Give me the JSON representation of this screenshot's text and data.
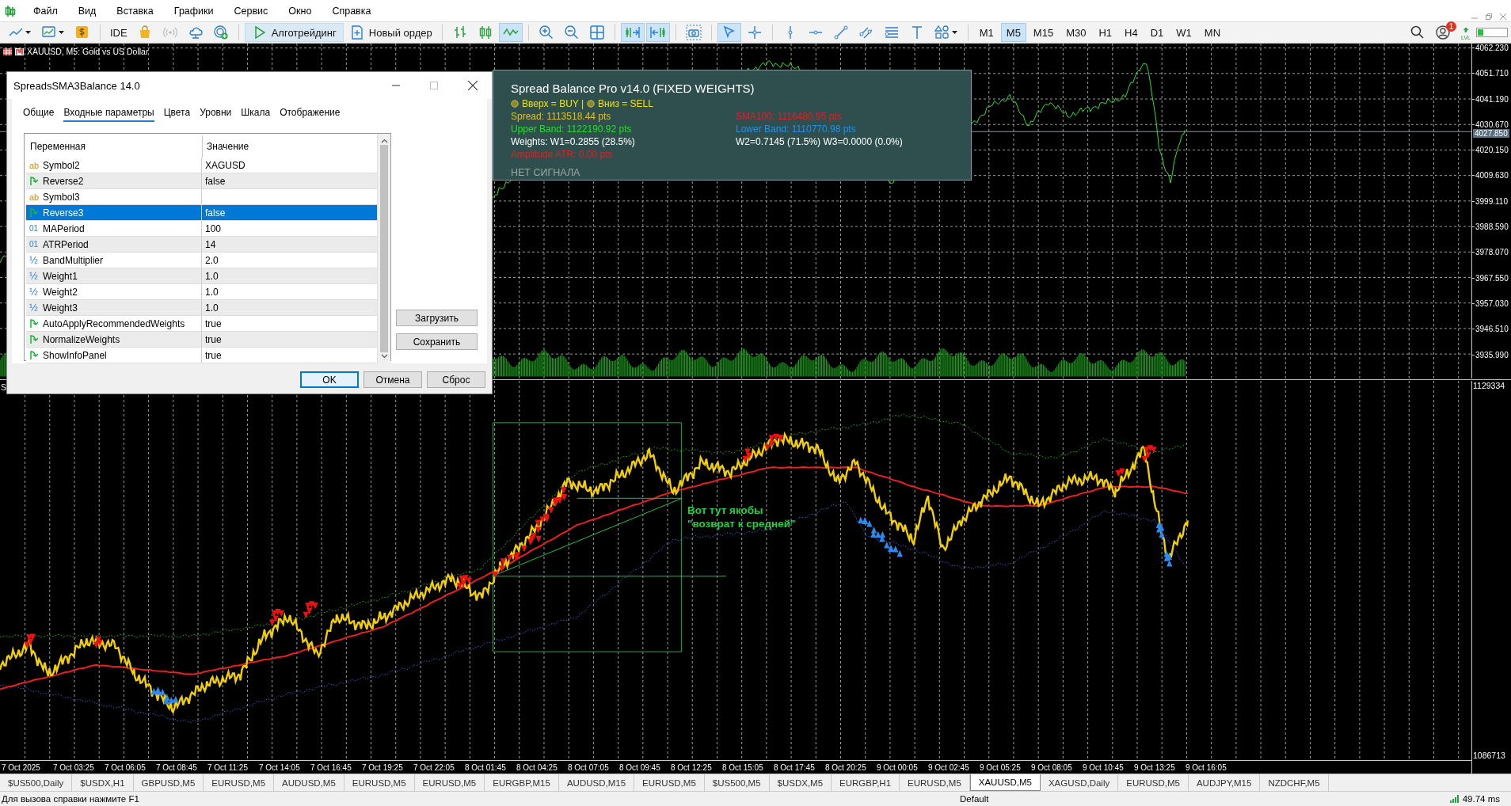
{
  "menu": [
    "Файл",
    "Вид",
    "Вставка",
    "Графики",
    "Сервис",
    "Окно",
    "Справка"
  ],
  "toolbar": {
    "ide_button": "IDE",
    "algo_button": "Алготрейдинг",
    "order_button": "Новый ордер",
    "timeframes": [
      {
        "label": "M1",
        "selected": false
      },
      {
        "label": "M5",
        "selected": true
      },
      {
        "label": "M15",
        "selected": false
      },
      {
        "label": "M30",
        "selected": false
      },
      {
        "label": "H1",
        "selected": false
      },
      {
        "label": "H4",
        "selected": false
      },
      {
        "label": "D1",
        "selected": false
      },
      {
        "label": "W1",
        "selected": false
      },
      {
        "label": "MN",
        "selected": false
      }
    ],
    "notification_count": "1",
    "level_label": "LVL"
  },
  "chart": {
    "title": "XAUUSD, M5:  Gold vs US Dollar",
    "indicator_title": "S",
    "price_scale": [
      "4062.230",
      "4051.710",
      "4041.190",
      "4030.670",
      "4020.150",
      "4009.630",
      "3999.110",
      "3988.590",
      "3978.070",
      "3967.550",
      "3957.030",
      "3946.510",
      "3935.990"
    ],
    "current_price": "4027.850",
    "indicator_scale": [
      "1129334",
      "1086713"
    ],
    "time_scale": [
      "7 Oct 2025",
      "7 Oct 03:25",
      "7 Oct 06:05",
      "7 Oct 08:45",
      "7 Oct 11:25",
      "7 Oct 14:05",
      "7 Oct 16:45",
      "7 Oct 19:25",
      "7 Oct 22:05",
      "8 Oct 01:45",
      "8 Oct 04:25",
      "8 Oct 07:05",
      "8 Oct 09:45",
      "8 Oct 12:25",
      "8 Oct 15:05",
      "8 Oct 17:45",
      "8 Oct 20:25",
      "9 Oct 00:05",
      "9 Oct 02:45",
      "9 Oct 05:25",
      "9 Oct 08:05",
      "9 Oct 10:45",
      "9 Oct 13:25",
      "9 Oct 16:05"
    ],
    "annotation": [
      "Вот тут якобы",
      "\"возврат к средней\""
    ]
  },
  "info_panel": {
    "title": "Spread Balance Pro v14.0 (FIXED WEIGHTS)",
    "legend": [
      "Вверх = BUY |",
      "Вниз = SELL"
    ],
    "lines": [
      {
        "text": "Spread: 1113518.44 pts",
        "color": "#e0c020"
      },
      {
        "text": "SMA100: 1116480.95 pts",
        "color": "#e02020"
      },
      {
        "text": "Upper Band: 1122190.92 pts",
        "color": "#20e020"
      },
      {
        "text": "Lower Band: 1110770.98 pts",
        "color": "#2090f0"
      },
      {
        "text": "Weights: W1=0.2855 (28.5%)",
        "color": "#ffffff"
      },
      {
        "text": "W2=0.7145 (71.5%) W3=0.0000 (0.0%)",
        "color": "#ffffff"
      },
      {
        "text": "Amplitude ATR: 0.00 pts",
        "color": "#e02020"
      }
    ],
    "signal": "НЕТ СИГНАЛА"
  },
  "dialog": {
    "title": "SpreadsSMA3Balance 14.0",
    "tabs": [
      {
        "label": "Общие",
        "selected": false
      },
      {
        "label": "Входные параметры",
        "selected": true
      },
      {
        "label": "Цвета",
        "selected": false
      },
      {
        "label": "Уровни",
        "selected": false
      },
      {
        "label": "Шкала",
        "selected": false
      },
      {
        "label": "Отображение",
        "selected": false
      }
    ],
    "columns": [
      "Переменная",
      "Значение"
    ],
    "rows": [
      {
        "kind": "string",
        "type_mark": "ab",
        "name": "Symbol2",
        "value": "XAGUSD",
        "selected": false
      },
      {
        "kind": "bool",
        "name": "Reverse2",
        "value": "false",
        "selected": false
      },
      {
        "kind": "string",
        "type_mark": "ab",
        "name": "Symbol3",
        "selected": false
      },
      {
        "kind": "bool",
        "name": "Reverse3",
        "value": "false",
        "selected": true
      },
      {
        "kind": "int",
        "type_mark": "01",
        "name": "MAPeriod",
        "value": "100",
        "selected": false
      },
      {
        "kind": "int",
        "type_mark": "01",
        "name": "ATRPeriod",
        "value": "14",
        "selected": false
      },
      {
        "kind": "double",
        "type_mark": "½",
        "name": "BandMultiplier",
        "value": "2.0",
        "selected": false
      },
      {
        "kind": "double",
        "type_mark": "½",
        "name": "Weight1",
        "value": "1.0",
        "selected": false
      },
      {
        "kind": "double",
        "type_mark": "½",
        "name": "Weight2",
        "value": "1.0",
        "selected": false
      },
      {
        "kind": "double",
        "type_mark": "½",
        "name": "Weight3",
        "value": "1.0",
        "selected": false
      },
      {
        "kind": "bool",
        "name": "AutoApplyRecommendedWeights",
        "value": "true",
        "selected": false
      },
      {
        "kind": "bool",
        "name": "NormalizeWeights",
        "value": "true",
        "selected": false
      },
      {
        "kind": "bool",
        "name": "ShowInfoPanel",
        "value": "true",
        "selected": false
      }
    ],
    "side_buttons": [
      "Загрузить",
      "Сохранить"
    ],
    "buttons": [
      "OK",
      "Отмена",
      "Сброс"
    ]
  },
  "symbol_tabs": [
    {
      "label": "$US500,Daily",
      "selected": false
    },
    {
      "label": "$USDX,H1",
      "selected": false
    },
    {
      "label": "GBPUSD,M5",
      "selected": false
    },
    {
      "label": "EURUSD,M5",
      "selected": false
    },
    {
      "label": "AUDUSD,M5",
      "selected": false
    },
    {
      "label": "EURUSD,M5",
      "selected": false
    },
    {
      "label": "EURUSD,M5",
      "selected": false
    },
    {
      "label": "EURGBP,M15",
      "selected": false
    },
    {
      "label": "AUDUSD,M15",
      "selected": false
    },
    {
      "label": "EURUSD,M5",
      "selected": false
    },
    {
      "label": "$US500,M5",
      "selected": false
    },
    {
      "label": "$USDX,M5",
      "selected": false
    },
    {
      "label": "EURGBP,H1",
      "selected": false
    },
    {
      "label": "EURUSD,M5",
      "selected": false
    },
    {
      "label": "XAUUSD,M5",
      "selected": true
    },
    {
      "label": "XAGUSD,Daily",
      "selected": false
    },
    {
      "label": "EURUSD,M5",
      "selected": false
    },
    {
      "label": "AUDJPY,M15",
      "selected": false
    },
    {
      "label": "NZDCHF,M5",
      "selected": false
    }
  ],
  "status_bar": {
    "help": "Для вызова справки нажмите F1",
    "profile": "Default",
    "ping": "49.74 ms"
  }
}
